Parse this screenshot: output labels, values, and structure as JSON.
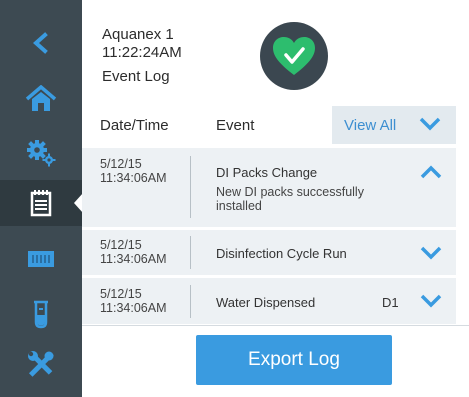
{
  "colors": {
    "sidebar": "#3d4a52",
    "sidebar_icon": "#3a9be0",
    "accent": "#3a9be0",
    "status_ok": "#2dbd6e",
    "row_background": "#edf1f4"
  },
  "sidebar": {
    "items": [
      {
        "name": "back",
        "icon": "chevron-left-icon"
      },
      {
        "name": "home",
        "icon": "home-icon"
      },
      {
        "name": "settings",
        "icon": "gears-icon"
      },
      {
        "name": "event-log",
        "icon": "notepad-icon",
        "active": true
      },
      {
        "name": "cartridge",
        "icon": "cartridge-icon"
      },
      {
        "name": "cylinder",
        "icon": "graduated-cylinder-icon"
      },
      {
        "name": "tools",
        "icon": "tools-icon"
      }
    ]
  },
  "header": {
    "device_name": "Aquanex 1",
    "time": "11:22:24AM",
    "page_title": "Event Log",
    "status_icon": "heart-check-icon"
  },
  "table": {
    "columns": {
      "date": "Date/Time",
      "event": "Event"
    },
    "view_all_label": "View All",
    "rows": [
      {
        "date": "5/12/15",
        "time": "11:34:06AM",
        "event": "DI Packs Change",
        "description": "New DI packs successfully installed",
        "station": "",
        "expanded": true
      },
      {
        "date": "5/12/15",
        "time": "11:34:06AM",
        "event": "Disinfection Cycle Run",
        "description": "",
        "station": "",
        "expanded": false
      },
      {
        "date": "5/12/15",
        "time": "11:34:06AM",
        "event": "Water Dispensed",
        "description": "",
        "station": "D1",
        "expanded": false
      }
    ]
  },
  "footer": {
    "export_label": "Export Log"
  }
}
